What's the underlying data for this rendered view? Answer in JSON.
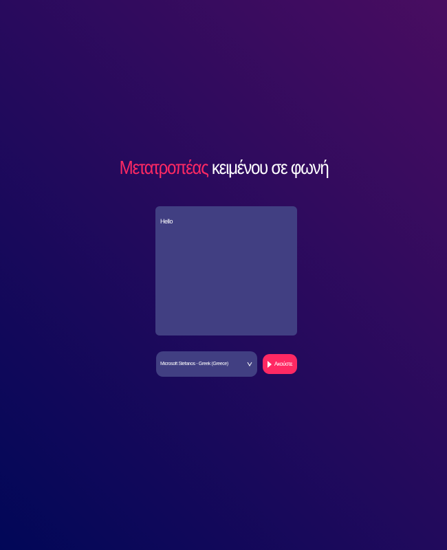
{
  "header": {
    "title_accent": "Μετατροπέας",
    "title_rest": "κειμένου σε φωνή"
  },
  "editor": {
    "text": "Hello"
  },
  "voice_select": {
    "selected": "Microsoft Stefanos - Greek (Greece)",
    "icon": "chevron-down-icon"
  },
  "listen_button": {
    "label": "Ακούστε",
    "icon": "play-icon"
  },
  "colors": {
    "accent": "#ff2963",
    "panel": "#413f82",
    "bg_start": "#010758",
    "bg_end": "#490d61"
  }
}
